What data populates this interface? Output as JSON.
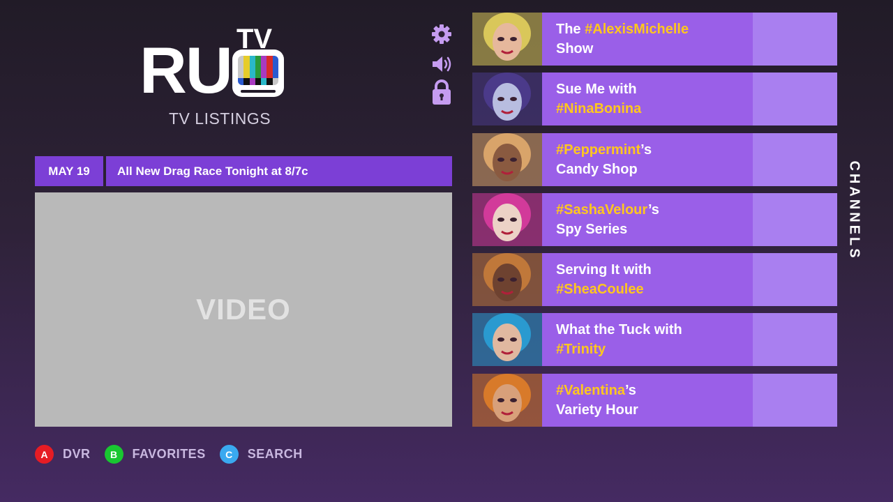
{
  "logo": {
    "brand": "RU",
    "tv": "TV",
    "subtitle": "TV LISTINGS"
  },
  "icons": {
    "settings": "gear-icon",
    "volume": "speaker-icon",
    "parental": "lock-icon"
  },
  "info_bar": {
    "date": "MAY 19",
    "headline": "All New Drag Race Tonight at 8/7c"
  },
  "video": {
    "label": "VIDEO"
  },
  "buttons": [
    {
      "key": "A",
      "label": "DVR",
      "color": "#e61c24"
    },
    {
      "key": "B",
      "label": "FAVORITES",
      "color": "#19c731"
    },
    {
      "key": "C",
      "label": "SEARCH",
      "color": "#3aa9f0"
    }
  ],
  "channels_label": "CHANNELS",
  "channels": [
    {
      "line1_pre": "The ",
      "line1_hl": "#AlexisMichelle",
      "line1_post": "",
      "line2_pre": "Show",
      "line2_hl": "",
      "line2_post": "",
      "skin": "#e6b89c",
      "hair": "#d9c75a"
    },
    {
      "line1_pre": "Sue Me with",
      "line1_hl": "",
      "line1_post": "",
      "line2_pre": "",
      "line2_hl": "#NinaBonina",
      "line2_post": "",
      "skin": "#b8bde0",
      "hair": "#4b3a8a"
    },
    {
      "line1_pre": "",
      "line1_hl": "#Peppermint",
      "line1_post": "’s",
      "line2_pre": "Candy Shop",
      "line2_hl": "",
      "line2_post": "",
      "skin": "#8a5a40",
      "hair": "#d9a46a"
    },
    {
      "line1_pre": "",
      "line1_hl": "#SashaVelour",
      "line1_post": "’s",
      "line2_pre": "Spy Series",
      "line2_hl": "",
      "line2_post": "",
      "skin": "#ecd2c6",
      "hair": "#d23a9a"
    },
    {
      "line1_pre": "Serving It with",
      "line1_hl": "",
      "line1_post": "",
      "line2_pre": "",
      "line2_hl": "#SheaCoulee",
      "line2_post": "",
      "skin": "#6e4230",
      "hair": "#c0783a"
    },
    {
      "line1_pre": "What the Tuck with",
      "line1_hl": "",
      "line1_post": "",
      "line2_pre": "",
      "line2_hl": "#Trinity",
      "line2_post": "",
      "skin": "#e0b8a0",
      "hair": "#2a9ad0"
    },
    {
      "line1_pre": "",
      "line1_hl": "#Valentina",
      "line1_post": "’s",
      "line2_pre": "Variety Hour",
      "line2_hl": "",
      "line2_post": "",
      "skin": "#d8a07a",
      "hair": "#d87a2a"
    }
  ]
}
